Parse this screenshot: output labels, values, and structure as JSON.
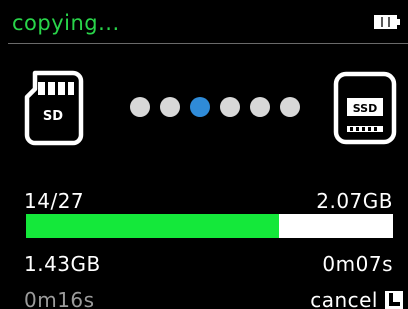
{
  "status": {
    "title": "copying...",
    "battery_level": 1
  },
  "transfer": {
    "source_icon": "sd-card-icon",
    "source_label": "SD",
    "destination_icon": "ssd-drive-icon",
    "destination_label": "SSD",
    "animation_dots_total": 6,
    "active_dot_index": 2,
    "file_count": "14/27",
    "total_size": "2.07GB",
    "copied_size": "1.43GB",
    "elapsed_time": "0m07s",
    "remaining_time": "0m16s",
    "progress_fraction": 0.69
  },
  "controls": {
    "cancel_label": "cancel",
    "cancel_key_icon": "l-key-icon"
  },
  "colors": {
    "status_green": "#29d54a",
    "progress_green": "#14e83a",
    "active_dot_blue": "#2f8bd8",
    "dim_text_gray": "#9b9b9b"
  }
}
